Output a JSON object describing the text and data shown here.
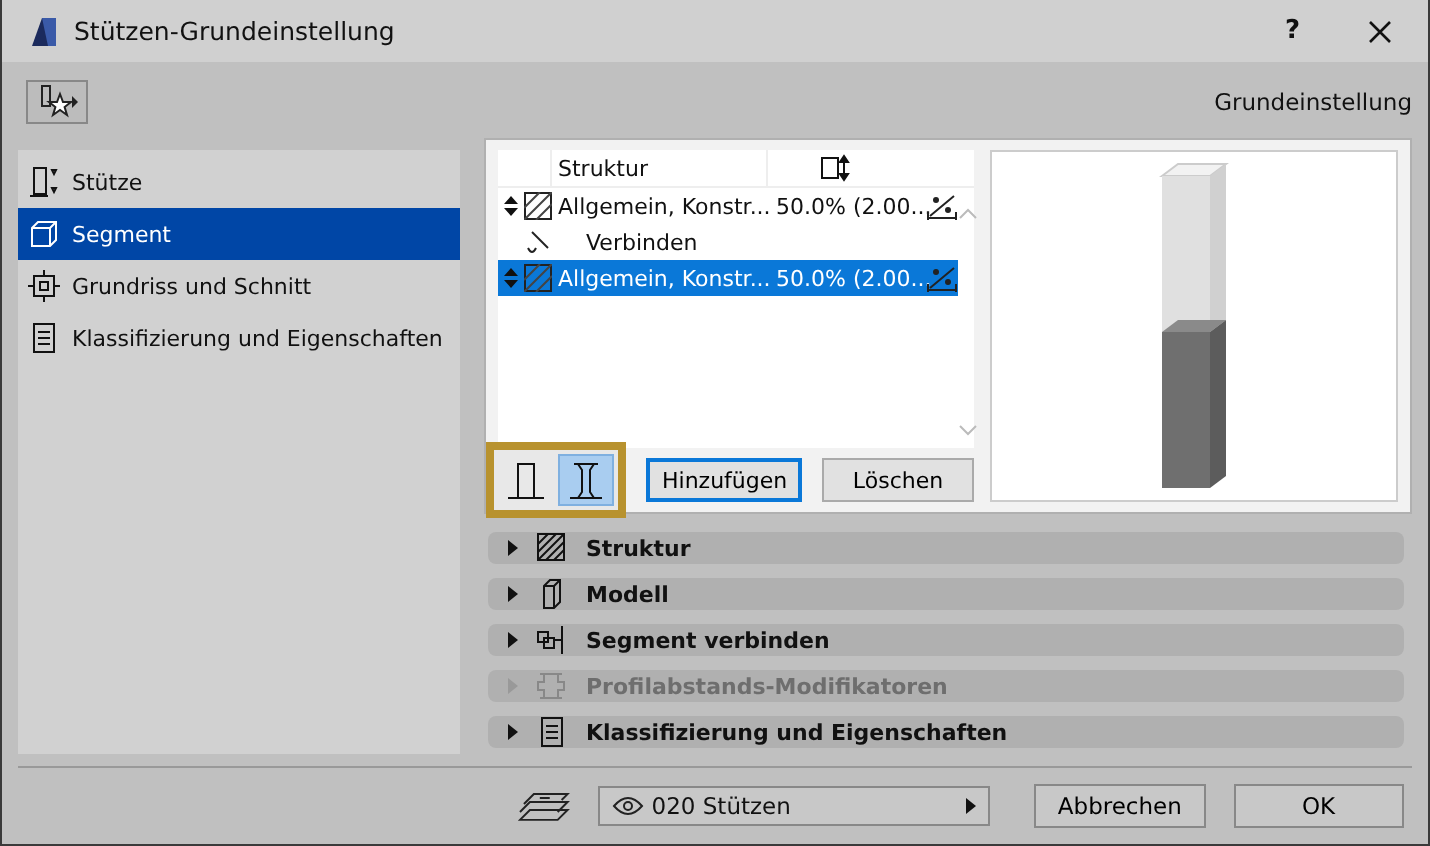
{
  "window": {
    "title": "Stützen-Grundeinstellung",
    "help": "?"
  },
  "header": {
    "label": "Grundeinstellung"
  },
  "sidebar": {
    "items": [
      {
        "label": "Stütze",
        "selected": false
      },
      {
        "label": "Segment",
        "selected": true
      },
      {
        "label": "Grundriss und Schnitt",
        "selected": false
      },
      {
        "label": "Klassifizierung und Eigenschaften",
        "selected": false
      }
    ]
  },
  "structure_table": {
    "columns": [
      "Struktur"
    ],
    "rows": [
      {
        "kind": "segment",
        "name": "Allgemein, Konstr...",
        "value": "50.0% (2.00...",
        "selected": false
      },
      {
        "kind": "joint",
        "name": "Verbinden",
        "selected": false
      },
      {
        "kind": "segment",
        "name": "Allgemein, Konstr...",
        "value": "50.0% (2.00...",
        "selected": true
      }
    ]
  },
  "mode_buttons": [
    {
      "kind": "plain",
      "selected": false
    },
    {
      "kind": "capped",
      "selected": true
    }
  ],
  "buttons": [
    {
      "label": "Hinzufügen",
      "focused": true
    },
    {
      "label": "Löschen",
      "focused": false
    }
  ],
  "panels": [
    {
      "label": "Struktur",
      "disabled": false
    },
    {
      "label": "Modell",
      "disabled": false
    },
    {
      "label": "Segment verbinden",
      "disabled": false
    },
    {
      "label": "Profilabstands-Modifikatoren",
      "disabled": true
    },
    {
      "label": "Klassifizierung und Eigenschaften",
      "disabled": false
    }
  ],
  "footer": {
    "layer": "020 Stützen",
    "buttons": [
      "Abbrechen",
      "OK"
    ]
  }
}
